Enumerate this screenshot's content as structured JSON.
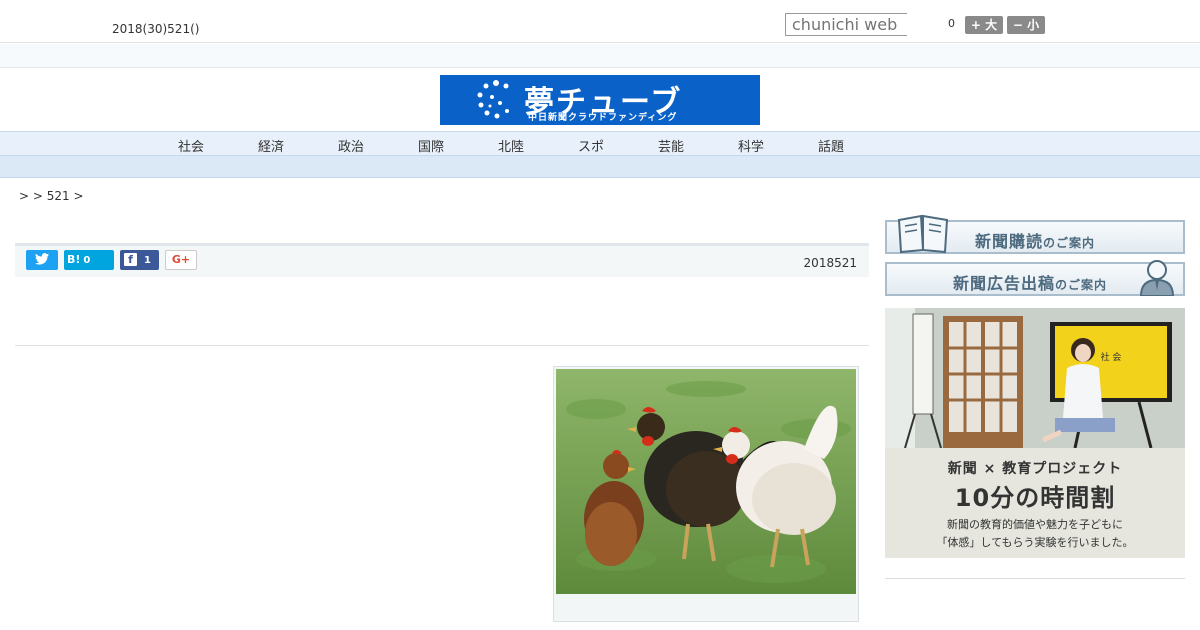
{
  "header": {
    "date_text": "2018(30)521()",
    "search_placeholder": "chunichi web",
    "counter": "0",
    "font_bigger": "+ 大",
    "font_smaller": "− 小"
  },
  "logo": {
    "main": "夢チューブ",
    "sub": "中日新聞クラウドファンディング"
  },
  "nav": {
    "items": [
      "社会",
      "経済",
      "政治",
      "国際",
      "北陸",
      "スポ",
      "芸能",
      "科学",
      "話題"
    ]
  },
  "breadcrumb": {
    "text": ">  > 521 >"
  },
  "share": {
    "hatena_label": "B!",
    "hatena_count": "0",
    "facebook_count": "1",
    "google_label": "G+",
    "article_date": "2018521"
  },
  "sidebar": {
    "subscribe": {
      "main": "新聞購読",
      "suffix": "のご案内"
    },
    "advertise": {
      "main": "新聞広告出稿",
      "suffix": "のご案内"
    },
    "banner": {
      "line1": "新聞 × 教育プロジェクト",
      "line2": "10分の時間割",
      "line3": "新聞の教育的価値や魅力を子どもに",
      "line4": "「体感」してもらう実験を行いました。",
      "screen_text": "社 会"
    }
  },
  "colors": {
    "logo_bg": "#0a62c9",
    "nav_bg": "#e8f1fb",
    "twitter": "#1da1f2",
    "hatena": "#00a4de",
    "facebook": "#3b5998"
  }
}
